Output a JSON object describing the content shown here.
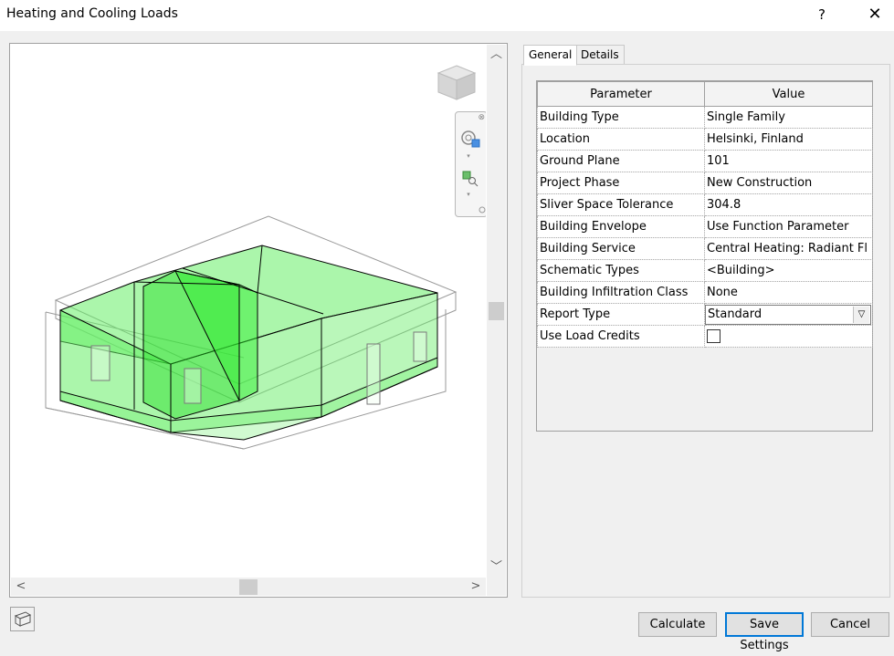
{
  "window": {
    "title": "Heating and Cooling Loads",
    "help_label": "?",
    "close_label": "✕"
  },
  "view": {
    "viewcube_label": "ViewCube",
    "colors": {
      "room_fill": "#66ee66",
      "room_stroke": "#000000",
      "outline": "#9a9a9a"
    }
  },
  "tabs": [
    {
      "label": "General",
      "active": true
    },
    {
      "label": "Details",
      "active": false
    }
  ],
  "grid": {
    "headers": {
      "parameter": "Parameter",
      "value": "Value"
    },
    "rows": [
      {
        "param": "Building Type",
        "value": "Single Family"
      },
      {
        "param": "Location",
        "value": "Helsinki, Finland"
      },
      {
        "param": "Ground Plane",
        "value": "101"
      },
      {
        "param": "Project Phase",
        "value": "New Construction"
      },
      {
        "param": "Sliver Space Tolerance",
        "value": "304.8"
      },
      {
        "param": "Building Envelope",
        "value": "Use Function Parameter"
      },
      {
        "param": "Building Service",
        "value": "Central Heating: Radiant Fl"
      },
      {
        "param": "Schematic Types",
        "value": "<Building>"
      },
      {
        "param": "Building Infiltration Class",
        "value": "None"
      },
      {
        "param": "Report Type",
        "value": "Standard"
      },
      {
        "param": "Use Load Credits",
        "value": ""
      }
    ]
  },
  "buttons": {
    "calculate": "Calculate",
    "save_settings": "Save Settings",
    "cancel": "Cancel"
  }
}
